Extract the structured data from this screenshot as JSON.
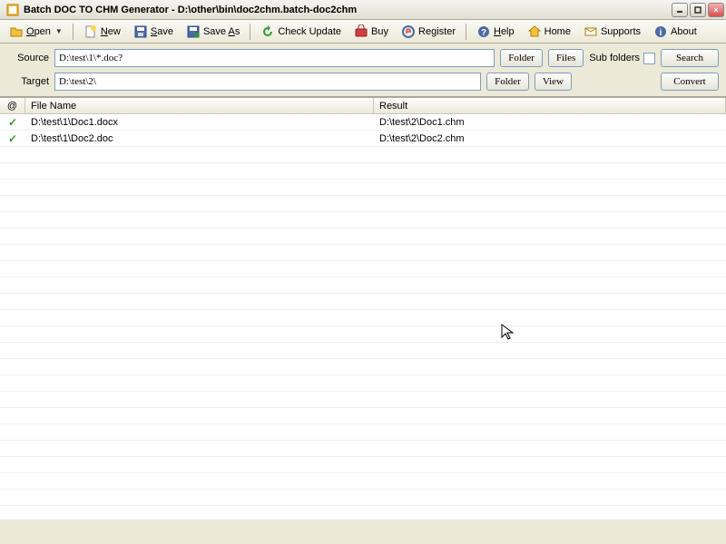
{
  "window": {
    "title": "Batch DOC TO CHM Generator - D:\\other\\bin\\doc2chm.batch-doc2chm"
  },
  "toolbar": {
    "open": "Open",
    "new": "New",
    "save": "Save",
    "saveas": "Save As",
    "checkupdate": "Check Update",
    "buy": "Buy",
    "register": "Register",
    "help": "Help",
    "home": "Home",
    "supports": "Supports",
    "about": "About"
  },
  "paths": {
    "source_label": "Source",
    "source_value": "D:\\test\\1\\*.doc?",
    "target_label": "Target",
    "target_value": "D:\\test\\2\\",
    "folder_btn": "Folder",
    "files_btn": "Files",
    "view_btn": "View",
    "subfolders_label": "Sub folders",
    "search_btn": "Search",
    "convert_btn": "Convert"
  },
  "list": {
    "header": {
      "at": "@",
      "filename": "File Name",
      "result": "Result"
    },
    "rows": [
      {
        "file": "D:\\test\\1\\Doc1.docx",
        "result": "D:\\test\\2\\Doc1.chm"
      },
      {
        "file": "D:\\test\\1\\Doc2.doc",
        "result": "D:\\test\\2\\Doc2.chm"
      }
    ]
  }
}
